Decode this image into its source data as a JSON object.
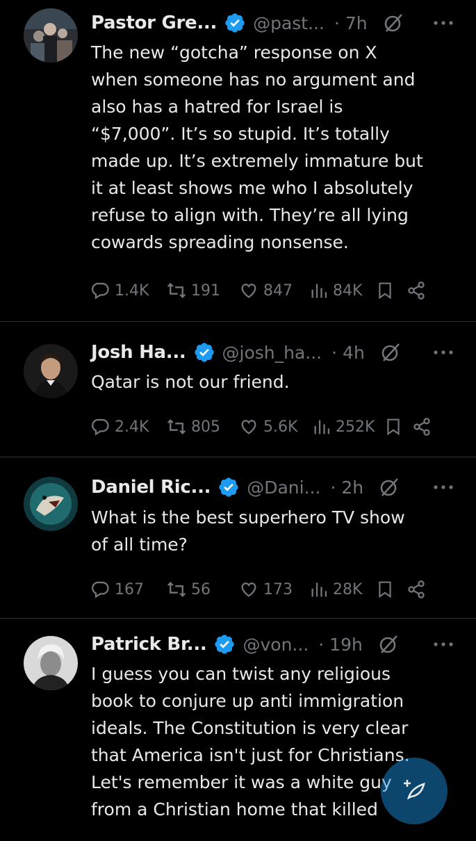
{
  "tweets": [
    {
      "name": "Pastor Gre...",
      "handle": "@past...",
      "time": "· 7h",
      "text": "The new “gotcha” response on X\nwhen someone has no argument and\nalso has a hatred for Israel is\n“$7,000”.  It’s so stupid. It’s totally\nmade up. It’s extremely immature but\nit at least shows me who I absolutely\nrefuse to align with. They’re all lying\ncowards spreading nonsense.",
      "replies": "1.4K",
      "reposts": "191",
      "likes": "847",
      "views": "84K"
    },
    {
      "name": "Josh Ha...",
      "handle": "@josh_ha...",
      "time": "· 4h",
      "text": "Qatar is not our friend.",
      "replies": "2.4K",
      "reposts": "805",
      "likes": "5.6K",
      "views": "252K"
    },
    {
      "name": "Daniel Ric...",
      "handle": "@Dani...",
      "time": "· 2h",
      "text": "What is the best superhero TV show\nof all time?",
      "replies": "167",
      "reposts": "56",
      "likes": "173",
      "views": "28K"
    },
    {
      "name": "Patrick Br...",
      "handle": "@von...",
      "time": "· 19h",
      "text": "I guess you can twist any religious\nbook to conjure up anti immigration\nideals. The Constitution is very clear\nthat America isn't just for Christians.\nLet's remember it was a white guy\nfrom a Christian home that killed"
    }
  ],
  "icons": {
    "verified": "verified-badge-icon",
    "grok": "grok-icon",
    "more": "more-options-icon",
    "reply": "reply-icon",
    "repost": "repost-icon",
    "like": "like-icon",
    "views": "views-icon",
    "bookmark": "bookmark-icon",
    "share": "share-icon",
    "compose": "compose-post-icon"
  },
  "colors": {
    "background": "#000000",
    "text": "#e7e9ea",
    "secondary": "#71767b",
    "verified": "#1d9bf0",
    "divider": "#2f3336"
  }
}
